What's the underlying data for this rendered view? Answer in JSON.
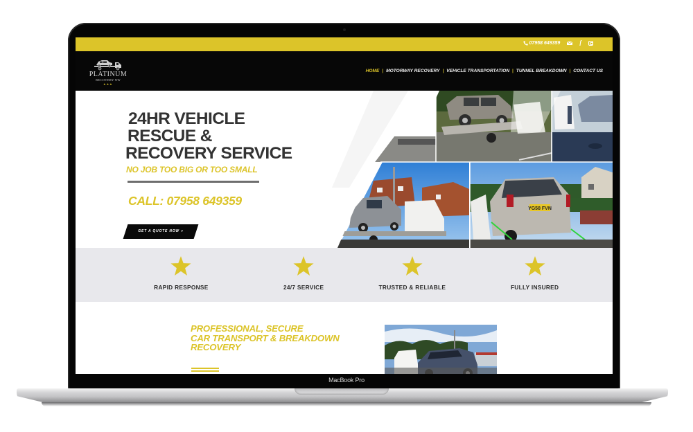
{
  "device": {
    "model_label": "MacBook Pro"
  },
  "topbar": {
    "phone": "07958 649359",
    "icons": [
      "phone-icon",
      "mail-icon",
      "facebook-icon",
      "instagram-icon"
    ],
    "facebook_glyph": "f"
  },
  "header": {
    "logo": {
      "name": "PLATINUM",
      "subtitle": "RECOVERY NW",
      "stars": "★★★"
    },
    "nav": [
      {
        "label": "HOME",
        "active": true
      },
      {
        "label": "MOTORWAY RECOVERY",
        "active": false
      },
      {
        "label": "VEHICLE TRANSPORTATION",
        "active": false
      },
      {
        "label": "TUNNEL BREAKDOWN",
        "active": false
      },
      {
        "label": "CONTACT US",
        "active": false
      }
    ],
    "nav_separator": "|"
  },
  "hero": {
    "title_lines": [
      "24HR VEHICLE",
      "RESCUE &",
      "RECOVERY SERVICE"
    ],
    "tagline": "NO JOB TOO BIG OR TOO SMALL",
    "call": "CALL: 07958 649359",
    "cta_label": "GET A QUOTE NOW »",
    "collage_plate": "YG58 FVN"
  },
  "features": [
    {
      "icon": "star-icon",
      "label": "RAPID RESPONSE"
    },
    {
      "icon": "star-icon",
      "label": "24/7 SERVICE"
    },
    {
      "icon": "star-icon",
      "label": "TRUSTED & RELIABLE"
    },
    {
      "icon": "star-icon",
      "label": "FULLY INSURED"
    }
  ],
  "section2": {
    "title_lines": [
      "PROFESSIONAL, SECURE",
      "CAR TRANSPORT & BREAKDOWN",
      "RECOVERY"
    ]
  },
  "colors": {
    "brand_yellow": "#dcc429",
    "header_black": "#070707",
    "heading_gray": "#333333",
    "features_bg": "#e8e8ec"
  }
}
